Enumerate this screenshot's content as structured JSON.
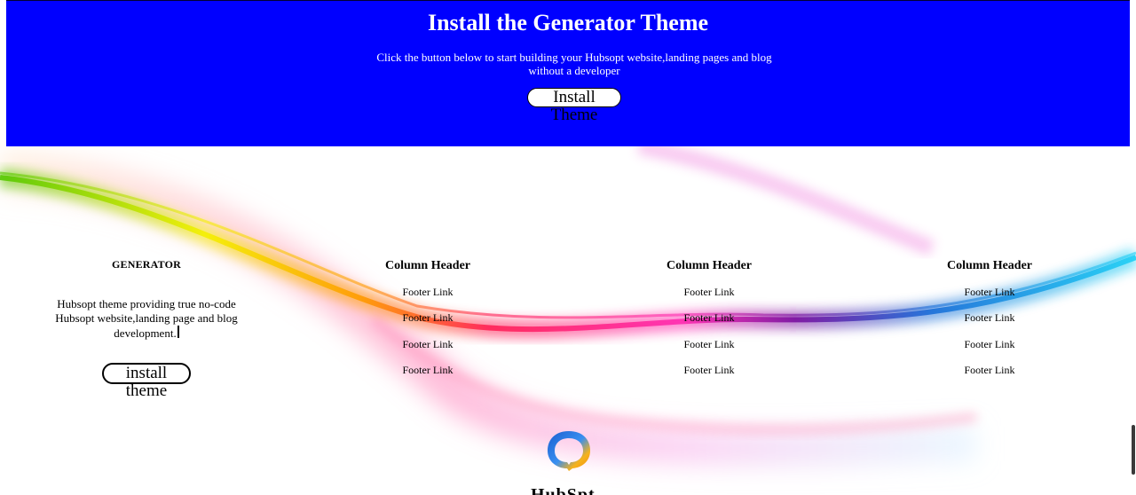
{
  "hero": {
    "title": "Install the Generator Theme",
    "subtitle": "Click the button below to start building your Hubsopt website,landing pages and blog without a developer",
    "button_label": "Install Theme",
    "background_color": "#0000ff"
  },
  "footer": {
    "brand": {
      "heading": "GENERATOR",
      "description": "Hubsopt theme providing true no-code Hubsopt website,landing page and blog development.",
      "button_label": "install theme"
    },
    "columns": [
      {
        "header": "Column Header",
        "links": [
          "Footer Link",
          "Footer Link",
          "Footer Link",
          "Footer Link"
        ]
      },
      {
        "header": "Column Header",
        "links": [
          "Footer Link",
          "Footer Link",
          "Footer Link",
          "Footer Link"
        ]
      },
      {
        "header": "Column Header",
        "links": [
          "Footer Link",
          "Footer Link",
          "Footer Link",
          "Footer Link"
        ]
      }
    ],
    "logo_icon": "speech-bubble-logo-icon",
    "logo_text": "HubSpt"
  }
}
